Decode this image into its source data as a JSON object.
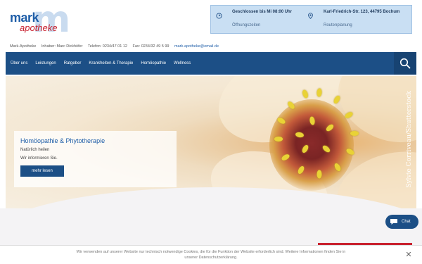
{
  "logo": {
    "mark": "mark",
    "apotheke": "apotheke"
  },
  "info": {
    "hours_status": "Geschlossen bis Mi 08:00 Uhr",
    "hours_link": "Öffnungszeiten",
    "address": "Karl-Friedrich-Str. 123, 44795 Bochum",
    "address_link": "Routenplanung"
  },
  "contact": {
    "name": "Mark-Apotheke",
    "owner": "Inhaber: Marc Dickhöfer",
    "phone": "Telefon: 0234/47 01 12",
    "fax": "Fax: 0234/32 49 5 99",
    "email": "mark-apotheke@email.de"
  },
  "nav": {
    "items": [
      "Über uns",
      "Leistungen",
      "Ratgeber",
      "Krankheiten & Therapie",
      "Homöopathie",
      "Wellness"
    ]
  },
  "hero": {
    "credit": "Sylvie Corriveau/Shutterstock",
    "card_title": "Homöopathie & Phytotherapie",
    "card_line1": "Natürlich heilen",
    "card_line2": "Wir informieren Sie.",
    "card_button": "mehr lesen"
  },
  "chat": {
    "label": "Chat"
  },
  "cookie": {
    "text": "Wir verwenden auf unserer Website nur technisch notwendige Cookies, die für die Funktion der Website erforderlich sind. Weitere Informationen finden Sie in unserer Datenschutzerklärung."
  },
  "colors": {
    "brand_blue": "#1c4f86",
    "brand_red": "#c8202e",
    "info_bg": "#c9dff3"
  }
}
